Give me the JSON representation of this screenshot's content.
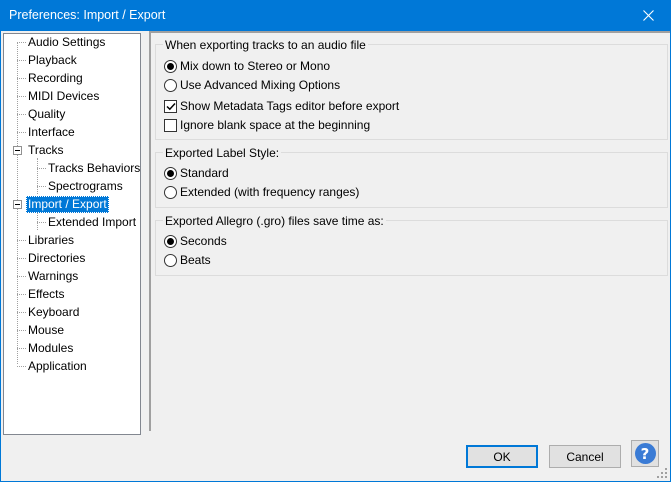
{
  "window": {
    "title": "Preferences: Import / Export",
    "close_icon": "close-icon"
  },
  "tree": {
    "items": [
      {
        "label": "Audio Settings"
      },
      {
        "label": "Playback"
      },
      {
        "label": "Recording"
      },
      {
        "label": "MIDI Devices"
      },
      {
        "label": "Quality"
      },
      {
        "label": "Interface"
      },
      {
        "label": "Tracks",
        "expanded": true
      },
      {
        "label": "Tracks Behaviors"
      },
      {
        "label": "Spectrograms"
      },
      {
        "label": "Import / Export",
        "expanded": true,
        "selected": true
      },
      {
        "label": "Extended Import"
      },
      {
        "label": "Libraries"
      },
      {
        "label": "Directories"
      },
      {
        "label": "Warnings"
      },
      {
        "label": "Effects"
      },
      {
        "label": "Keyboard"
      },
      {
        "label": "Mouse"
      },
      {
        "label": "Modules"
      },
      {
        "label": "Application"
      }
    ]
  },
  "export_group": {
    "title": "When exporting tracks to an audio file",
    "mix_down": {
      "label": "Mix down to Stereo or Mono",
      "checked": true
    },
    "advanced_mixing": {
      "label": "Use Advanced Mixing Options",
      "checked": false
    },
    "show_metadata": {
      "label": "Show Metadata Tags editor before export",
      "checked": true
    },
    "ignore_blank": {
      "label": "Ignore blank space at the beginning",
      "checked": false
    }
  },
  "label_style_group": {
    "title": "Exported Label Style:",
    "standard": {
      "label": "Standard",
      "checked": true
    },
    "extended": {
      "label": "Extended (with frequency ranges)",
      "checked": false
    }
  },
  "allegro_group": {
    "title": "Exported Allegro (.gro) files save time as:",
    "seconds": {
      "label": "Seconds",
      "checked": true
    },
    "beats": {
      "label": "Beats",
      "checked": false
    }
  },
  "buttons": {
    "ok": "OK",
    "cancel": "Cancel",
    "help": "?"
  },
  "colors": {
    "titlebar": "#0078d7",
    "selection": "#0078d7",
    "help_icon": "#3a7bd5"
  }
}
